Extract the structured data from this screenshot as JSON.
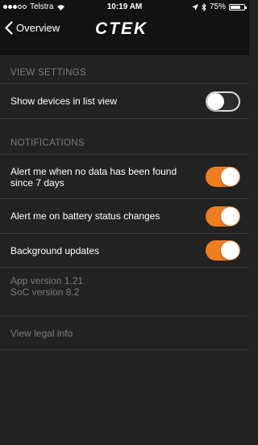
{
  "status": {
    "carrier": "Telstra",
    "time": "10:19 AM",
    "battery": "75%",
    "battery_level": 0.75
  },
  "nav": {
    "back_label": "Overview",
    "logo": "CTEK"
  },
  "view_settings": {
    "header": "VIEW SETTINGS",
    "list_view_label": "Show devices in list view",
    "list_view_on": false
  },
  "notifications": {
    "header": "NOTIFICATIONS",
    "no_data_label": "Alert me when no data has been found since 7 days",
    "no_data_on": true,
    "battery_status_label": "Alert me on battery status changes",
    "battery_status_on": true,
    "background_label": "Background updates",
    "background_on": true
  },
  "info": {
    "app_version": "App version 1.21",
    "soc_version": "SoC version 8.2",
    "legal": "View legal info"
  },
  "colors": {
    "accent": "#f07d1e",
    "background": "#222222",
    "header_bar": "#121212"
  }
}
